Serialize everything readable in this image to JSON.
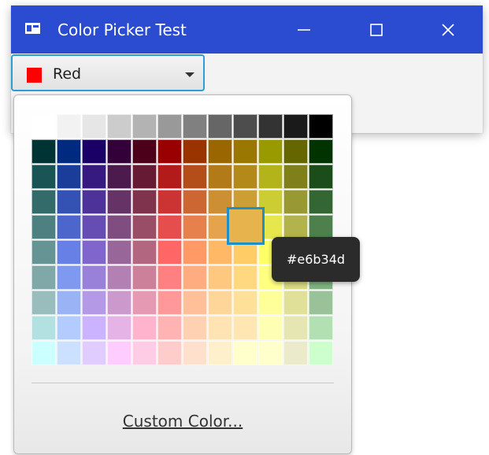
{
  "window": {
    "title": "Color Picker Test",
    "title_bar_color": "#2b4bd0",
    "controls": [
      "minimize-icon",
      "maximize-icon",
      "close-icon"
    ]
  },
  "combo": {
    "label": "Red",
    "swatch_color": "#ff0000",
    "focus_color": "#2a9fd6"
  },
  "palette": {
    "rows": [
      [
        "#ffffff",
        "#f2f2f2",
        "#e6e6e6",
        "#cccccc",
        "#b3b3b3",
        "#999999",
        "#808080",
        "#666666",
        "#4d4d4d",
        "#333333",
        "#1a1a1a",
        "#000000"
      ],
      [
        "#003333",
        "#002a80",
        "#1a0066",
        "#33003a",
        "#4d0019",
        "#990000",
        "#993300",
        "#996600",
        "#997700",
        "#999900",
        "#666600",
        "#003300"
      ],
      [
        "#1a5454",
        "#1a3d99",
        "#361a80",
        "#4d1a4d",
        "#661a33",
        "#b31a1a",
        "#b34d1a",
        "#b37a1a",
        "#b38a1a",
        "#b3b31a",
        "#80801a",
        "#1a4d1a"
      ],
      [
        "#336b6b",
        "#3352b3",
        "#4d3399",
        "#663366",
        "#80334d",
        "#cc3333",
        "#cc6633",
        "#cc8f33",
        "#cc9e33",
        "#cccc33",
        "#999933",
        "#336633"
      ],
      [
        "#4d8080",
        "#4d66cc",
        "#664db3",
        "#804d80",
        "#994d66",
        "#e64d4d",
        "#e6804d",
        "#e6a34d",
        "#e6b34d",
        "#e6e64d",
        "#b3b34d",
        "#4d804d"
      ],
      [
        "#669494",
        "#6680e6",
        "#8066cc",
        "#996699",
        "#b36680",
        "#ff6666",
        "#ff9966",
        "#ffb866",
        "#ffcc66",
        "#ffff66",
        "#cccc66",
        "#669966"
      ],
      [
        "#80a8a8",
        "#8099f0",
        "#9980d9",
        "#b380b3",
        "#cc8099",
        "#ff8080",
        "#ffad80",
        "#ffc880",
        "#ffd880",
        "#ffff80",
        "#d9d980",
        "#80b380"
      ],
      [
        "#99bcbc",
        "#99b3f5",
        "#b399e6",
        "#cc99cc",
        "#e699b3",
        "#ff9999",
        "#ffbf99",
        "#ffd699",
        "#ffe099",
        "#ffff99",
        "#e0e099",
        "#99c299"
      ],
      [
        "#b3e0e0",
        "#b3ccff",
        "#ccb3ff",
        "#e6b3e6",
        "#ffb3cc",
        "#ffb3b3",
        "#ffd1b3",
        "#ffe3b3",
        "#ffe6b3",
        "#ffffb3",
        "#e6e6b3",
        "#b3e0b3"
      ],
      [
        "#ccffff",
        "#cce0ff",
        "#e0ccff",
        "#ffccff",
        "#ffcce6",
        "#ffcccc",
        "#ffe0cc",
        "#fff0cc",
        "#ffffcc",
        "#ffffcc",
        "#ebebcc",
        "#ccffcc"
      ]
    ],
    "hover_color": "#e6b34d"
  },
  "tooltip": {
    "text": "#e6b34d"
  },
  "custom_color_label": "Custom Color..."
}
